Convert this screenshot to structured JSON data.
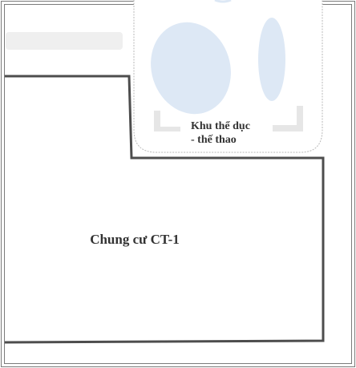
{
  "map": {
    "labels": {
      "sports_area_line1": "Khu thể dục",
      "sports_area_line2": "- thế thao",
      "building": "Chung cư CT-1"
    },
    "colors": {
      "frame": "#7a7a7a",
      "wall": "#4d4d4d",
      "sports_outline": "#b9b9b9",
      "sports_fill": "#ffffff",
      "ellipse_fill": "#dde8f5",
      "road_strip": "#efefef",
      "corner_marks": "#e6e6e6",
      "label_text": "#333333"
    }
  }
}
